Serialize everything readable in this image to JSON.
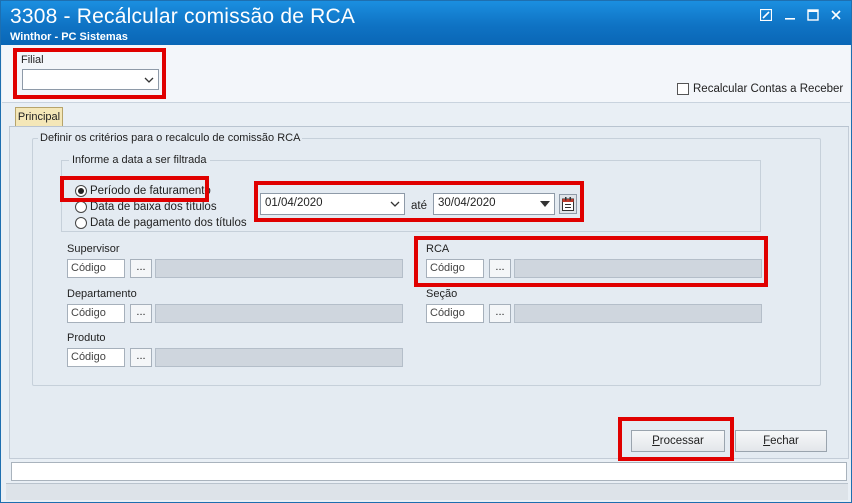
{
  "window": {
    "title": "3308 - Recálcular comissão de RCA",
    "subtitle": "Winthor - PC Sistemas"
  },
  "filial": {
    "label": "Filial",
    "value": ""
  },
  "recalcular_contas": {
    "label": "Recalcular Contas a Receber",
    "checked": false
  },
  "tabs": [
    {
      "label": "Principal",
      "active": true
    }
  ],
  "criteria": {
    "legend": "Definir os critérios para o recalculo de comissão RCA",
    "date_group": {
      "legend": "Informe a data a ser filtrada",
      "options": [
        {
          "label": "Período de faturamento",
          "selected": true
        },
        {
          "label": "Data de baixa dos títulos",
          "selected": false
        },
        {
          "label": "Data de pagamento dos títulos",
          "selected": false
        }
      ],
      "date_from": "01/04/2020",
      "ate_label": "até",
      "date_to": "30/04/2020"
    }
  },
  "fields": {
    "supervisor": {
      "label": "Supervisor",
      "code_placeholder": "Código",
      "dots": "..."
    },
    "rca": {
      "label": "RCA",
      "code_placeholder": "Código",
      "dots": "..."
    },
    "departamento": {
      "label": "Departamento",
      "code_placeholder": "Código",
      "dots": "..."
    },
    "secao": {
      "label": "Seção",
      "code_placeholder": "Código",
      "dots": "..."
    },
    "produto": {
      "label": "Produto",
      "code_placeholder": "Código",
      "dots": "..."
    }
  },
  "buttons": {
    "processar_prefix": "P",
    "processar_rest": "rocessar",
    "fechar_prefix": "F",
    "fechar_rest": "echar"
  },
  "colors": {
    "titlebar": "#0f73c4",
    "highlight": "#e00000",
    "tab_active": "#f4e7b8"
  }
}
